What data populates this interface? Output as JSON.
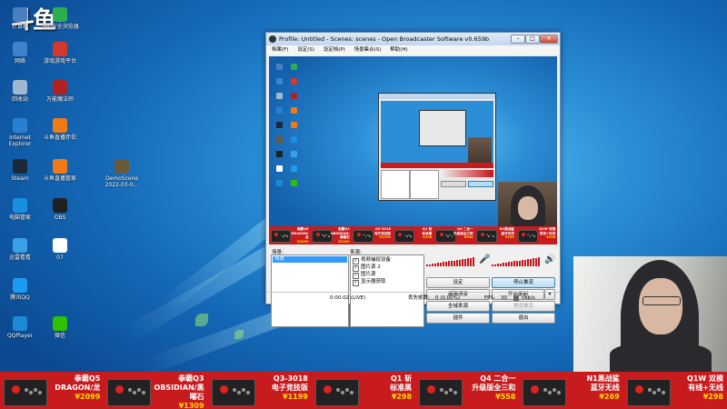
{
  "desktop": {
    "logo": "斗鱼",
    "icons": [
      {
        "label": "计算机",
        "color": "#4a7fc1"
      },
      {
        "label": "360安全浏览器",
        "color": "#2fae4f"
      },
      {
        "label": "网络",
        "color": "#3c83cc"
      },
      {
        "label": "游戏游戏平台",
        "color": "#d33a2c"
      },
      {
        "label": "回收站",
        "color": "#9fb7cf"
      },
      {
        "label": "万能魔法师",
        "color": "#b02222"
      },
      {
        "label": "Internet Explorer",
        "color": "#2b7fd1"
      },
      {
        "label": "斗鱼直播伴侣",
        "color": "#f07a16"
      },
      {
        "label": "Steam",
        "color": "#1b2838"
      },
      {
        "label": "斗鱼直播管家",
        "color": "#f07a16"
      },
      {
        "label": "DemoScene 2022-03-0...",
        "color": "#6b5a3a"
      },
      {
        "label": "电脑管家",
        "color": "#1a8fe0"
      },
      {
        "label": "OBS",
        "color": "#202020"
      },
      {
        "label": "迅雷看看",
        "color": "#3aa0e8"
      },
      {
        "label": "07",
        "color": "#ffffff"
      },
      {
        "label": "腾讯QQ",
        "color": "#1d9bf0"
      },
      {
        "label": "QQPlayer",
        "color": "#1e8ad6"
      },
      {
        "label": "微信",
        "color": "#2dc100"
      }
    ]
  },
  "obs": {
    "title": "Profile: Untitled - Scenes: scenes - Open Broadcaster Software v0.659b",
    "window_buttons": [
      "–",
      "□",
      "✕"
    ],
    "menu": [
      "档案(F)",
      "设定(S)",
      "设定档(P)",
      "场景集合(S)",
      "帮助(H)"
    ],
    "scenes_label": "场景:",
    "scenes": [
      "场景"
    ],
    "sources_label": "来源:",
    "sources": [
      "视频捕捉设备",
      "图片源 2",
      "图片源",
      "显示器获取"
    ],
    "buttons": {
      "settings": "设定",
      "stop_stream": "停止推流",
      "edit_scene": "编辑场景",
      "start_recording": "开始录制",
      "global_sources": "全域来源",
      "preview_stream": "预览推流",
      "plugins": "插件",
      "exit": "退出"
    },
    "status": {
      "time": "0:00:02 (LIVE)",
      "dropped_label": "丢失帧数:",
      "dropped_value": "0 (0.00%)",
      "fps_label": "FPS:",
      "fps_value": "30",
      "bitrate": "0kb/s"
    }
  },
  "banner": {
    "products": [
      {
        "name": "拳霸Q5",
        "sub": "DRAGON/龙",
        "price": "2099"
      },
      {
        "name": "拳霸Q3",
        "sub": "OBSIDIAN/黑曜石",
        "price": "1309"
      },
      {
        "name": "Q3-3018",
        "sub": "电子竞技版",
        "price": "1199"
      },
      {
        "name": "Q1 斩",
        "sub": "标准黑",
        "price": "298"
      },
      {
        "name": "Q4 二合一",
        "sub": "升级版全三和",
        "price": "558"
      },
      {
        "name": "N1黑战鲨",
        "sub": "蓝牙无线",
        "price": "269"
      },
      {
        "name": "Q1W 双模",
        "sub": "有线+无线",
        "price": "298"
      }
    ],
    "price_prefix": "¥"
  },
  "colors": {
    "banner_red": "#c81b1e",
    "price_gold": "#ffd700",
    "selection_blue": "#3399ff",
    "volume_red": "#c4161c"
  }
}
